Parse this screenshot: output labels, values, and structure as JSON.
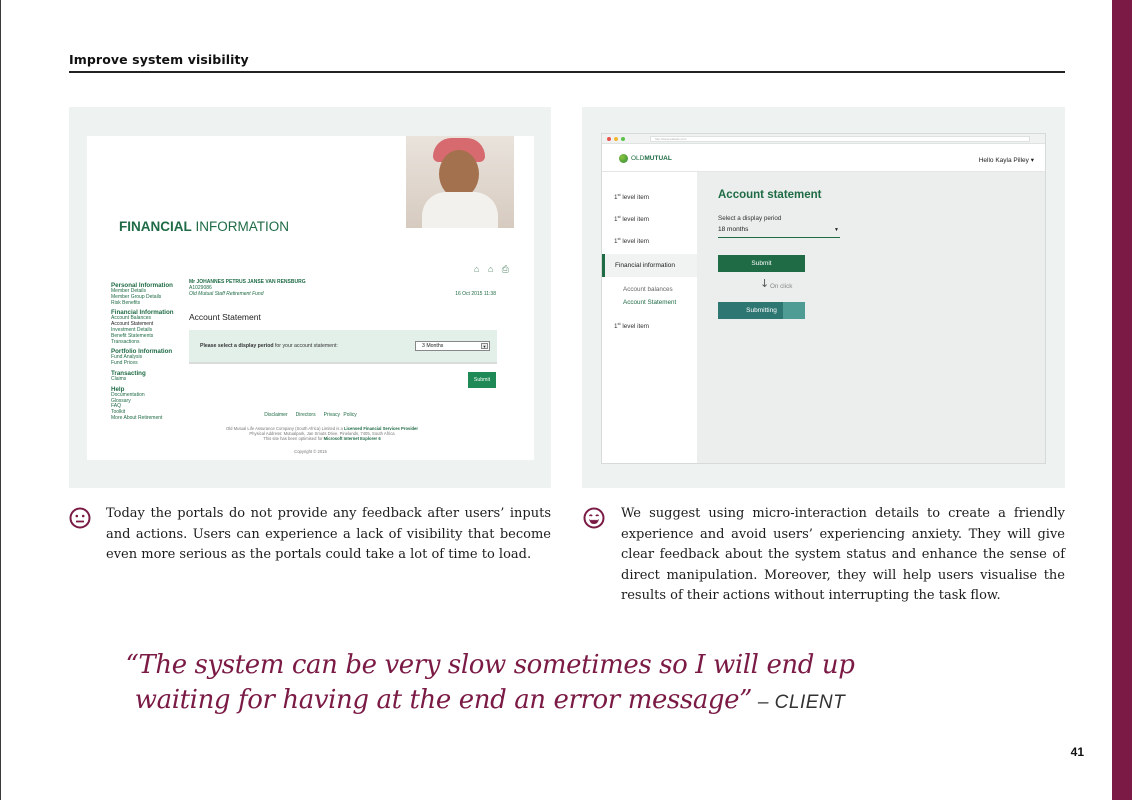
{
  "page": {
    "section_title": "Improve system visibility",
    "page_number": "41",
    "colors": {
      "brand": "#7a1a45",
      "green": "#1f6b45"
    }
  },
  "legacy": {
    "title_bold": "FINANCIAL",
    "title_rest": " INFORMATION",
    "tool_icons": "⌂ ⌂ ⎙",
    "nav": [
      {
        "type": "grp",
        "label": "Personal Information"
      },
      {
        "type": "item",
        "label": "Member Details"
      },
      {
        "type": "item",
        "label": "Member Group Details"
      },
      {
        "type": "item",
        "label": "Risk Benefits"
      },
      {
        "type": "grp",
        "label": "Financial Information"
      },
      {
        "type": "item",
        "label": "Account Balances"
      },
      {
        "type": "sel",
        "label": "Account Statement"
      },
      {
        "type": "item",
        "label": "Investment Details"
      },
      {
        "type": "item",
        "label": "Benefit Statements"
      },
      {
        "type": "item",
        "label": "Transactions"
      },
      {
        "type": "grp",
        "label": "Portfolio Information"
      },
      {
        "type": "item",
        "label": "Fund Analysis"
      },
      {
        "type": "item",
        "label": "Fund Prices"
      },
      {
        "type": "grp",
        "label": "Transacting"
      },
      {
        "type": "item",
        "label": "Claims"
      },
      {
        "type": "grp",
        "label": "Help"
      },
      {
        "type": "item",
        "label": "Documentation"
      },
      {
        "type": "item",
        "label": "Glossary"
      },
      {
        "type": "item",
        "label": "FAQ"
      },
      {
        "type": "item",
        "label": "Toolkit"
      },
      {
        "type": "item",
        "label": "More About Retirement"
      }
    ],
    "member_name": "Mr JOHANNES PETRUS JANSE VAN RENSBURG",
    "member_id": "A1029086",
    "member_fund": "Old Mutual Staff Retirement Fund",
    "member_date": "16 Oct 2015 11:38",
    "account_title": "Account Statement",
    "prompt_bold": "Please select a display period",
    "prompt_rest": " for your account statement:",
    "select_value": "3 Months",
    "submit_label": "Submit",
    "footer_links": [
      "Disclaimer",
      "Directors",
      "Privacy Policy"
    ],
    "company_line1": "Old Mutual Life Assurance Company (South Africa) Limited is a ",
    "company_link": "Licensed Financial Services Provider",
    "company_line2": "Physical Address: Mutualpark, Jan Smuts Drive, Pinelands, 7405, South Africa",
    "company_line3": "This site has been optimised for ",
    "company_browser": "Microsoft Internet Explorer 6",
    "copyright": "Copyright © 2015"
  },
  "mock": {
    "url": "http://www.website.com",
    "logo_light": "OLD",
    "logo_bold": "MUTUAL",
    "greeting": "Hello Kayla Pilley ▾",
    "nav_items": [
      {
        "num": "1",
        "sup": "st",
        "label": " level item"
      },
      {
        "num": "1",
        "sup": "st",
        "label": " level item"
      },
      {
        "num": "1",
        "sup": "st",
        "label": " level item"
      }
    ],
    "nav_active": "Financial information",
    "sub_items": [
      "Account balances",
      "Account Statement"
    ],
    "nav_last": {
      "num": "1",
      "sup": "st",
      "label": " level item"
    },
    "heading": "Account statement",
    "period_label": "Select a display period",
    "period_value": "18 months",
    "submit_label": "Submit",
    "arrow": "↓",
    "on_click": "On click",
    "submitting_label": "Submitting",
    "submitting_progress": 0.75
  },
  "captions": {
    "left": "Today the portals do not provide any feedback after users’ inputs and actions. Users can experience a lack of visibility that become even more serious as the portals could take a lot of time to load.",
    "right": "We suggest using micro-interaction details to create a friendly experience and avoid users’ experiencing anxiety. They will give clear feedback about the system status and enhance the sense of direct manipulation. Moreover, they will help users visualise the results of their actions without interrupting the task flow.",
    "left_icon": "neutral-face-icon",
    "right_icon": "smiling-face-icon"
  },
  "quote": {
    "text": "“The system can be very slow sometimes so I will end up waiting for having at the end an error message”",
    "dash": " – ",
    "attribution": "CLIENT"
  }
}
